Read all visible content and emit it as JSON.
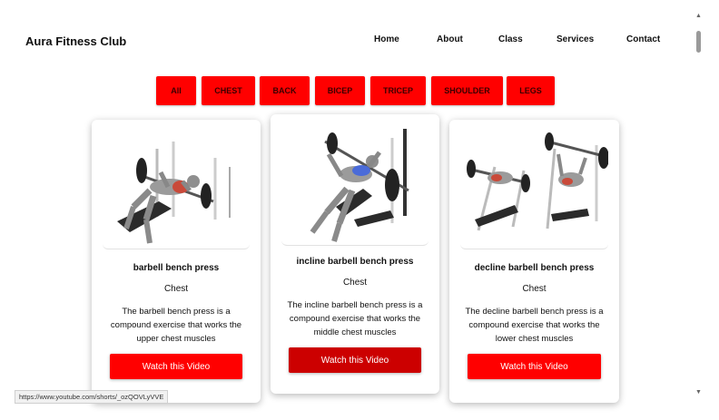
{
  "navbar": {
    "brand": "Aura Fitness Club",
    "links": [
      "Home",
      "About",
      "Class",
      "Services",
      "Contact"
    ]
  },
  "filters": [
    "All",
    "CHEST",
    "BACK",
    "BICEP",
    "TRICEP",
    "SHOULDER",
    "LEGS"
  ],
  "cards": [
    {
      "title": "barbell bench press",
      "category": "Chest",
      "description": "The barbell bench press is a compound exercise that works the upper chest muscles",
      "button": "Watch this Video"
    },
    {
      "title": "incline barbell bench press",
      "category": "Chest",
      "description": "The incline barbell bench press is a compound exercise that works the middle chest muscles",
      "button": "Watch this Video"
    },
    {
      "title": "decline barbell bench press",
      "category": "Chest",
      "description": "The decline barbell bench press is a compound exercise that works the lower chest muscles",
      "button": "Watch this Video"
    }
  ],
  "status_url": "https://www.youtube.com/shorts/_ozQOVLyVVE",
  "colors": {
    "accent": "#ff0000",
    "accent_hover": "#cc0000"
  }
}
